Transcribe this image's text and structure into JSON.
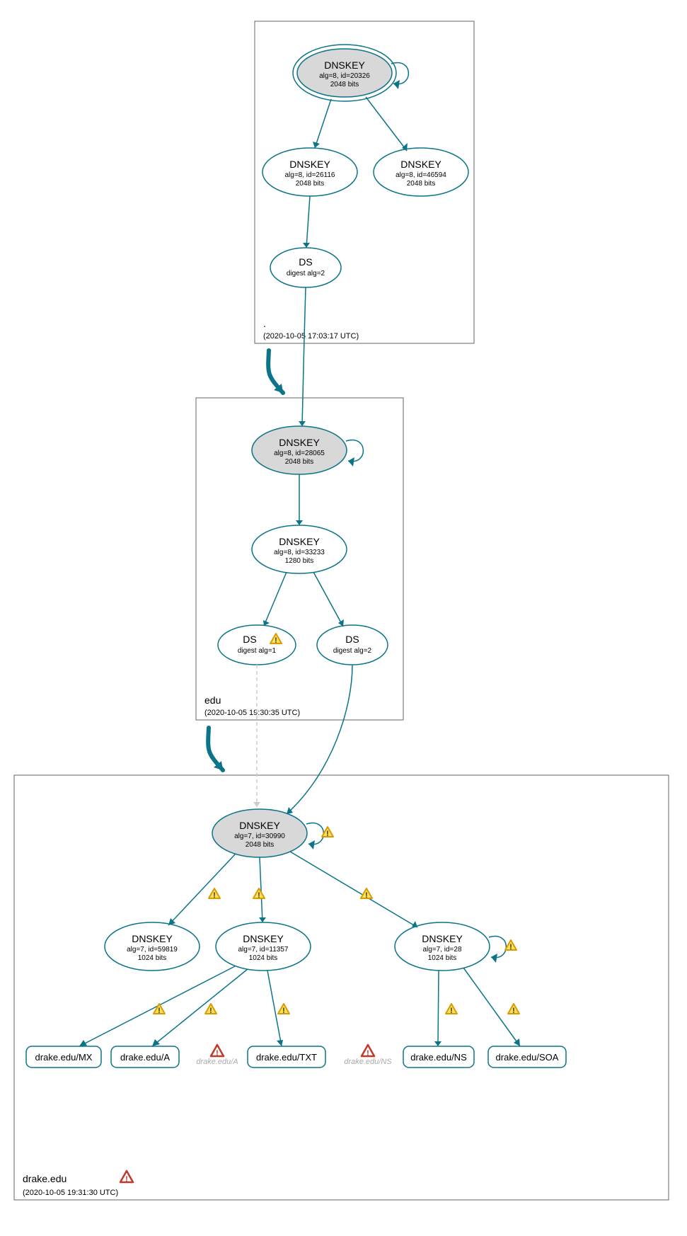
{
  "zones": {
    "root": {
      "label": ".",
      "timestamp": "(2020-10-05 17:03:17 UTC)"
    },
    "edu": {
      "label": "edu",
      "timestamp": "(2020-10-05 19:30:35 UTC)"
    },
    "drake": {
      "label": "drake.edu",
      "timestamp": "(2020-10-05 19:31:30 UTC)"
    }
  },
  "nodes": {
    "root_ksk": {
      "title": "DNSKEY",
      "line2": "alg=8, id=20326",
      "line3": "2048 bits"
    },
    "root_zsk1": {
      "title": "DNSKEY",
      "line2": "alg=8, id=26116",
      "line3": "2048 bits"
    },
    "root_zsk2": {
      "title": "DNSKEY",
      "line2": "alg=8, id=46594",
      "line3": "2048 bits"
    },
    "root_ds": {
      "title": "DS",
      "line2": "digest alg=2"
    },
    "edu_ksk": {
      "title": "DNSKEY",
      "line2": "alg=8, id=28065",
      "line3": "2048 bits"
    },
    "edu_zsk": {
      "title": "DNSKEY",
      "line2": "alg=8, id=33233",
      "line3": "1280 bits"
    },
    "edu_ds1": {
      "title": "DS",
      "line2": "digest alg=1"
    },
    "edu_ds2": {
      "title": "DS",
      "line2": "digest alg=2"
    },
    "drake_ksk": {
      "title": "DNSKEY",
      "line2": "alg=7, id=30990",
      "line3": "2048 bits"
    },
    "drake_zsk1": {
      "title": "DNSKEY",
      "line2": "alg=7, id=59819",
      "line3": "1024 bits"
    },
    "drake_zsk2": {
      "title": "DNSKEY",
      "line2": "alg=7, id=11357",
      "line3": "1024 bits"
    },
    "drake_zsk3": {
      "title": "DNSKEY",
      "line2": "alg=7, id=28",
      "line3": "1024 bits"
    },
    "rr_mx": {
      "label": "drake.edu/MX"
    },
    "rr_a": {
      "label": "drake.edu/A"
    },
    "rr_txt": {
      "label": "drake.edu/TXT"
    },
    "rr_ns": {
      "label": "drake.edu/NS"
    },
    "rr_soa": {
      "label": "drake.edu/SOA"
    },
    "ghost_a": {
      "label": "drake.edu/A"
    },
    "ghost_ns": {
      "label": "drake.edu/NS"
    }
  }
}
